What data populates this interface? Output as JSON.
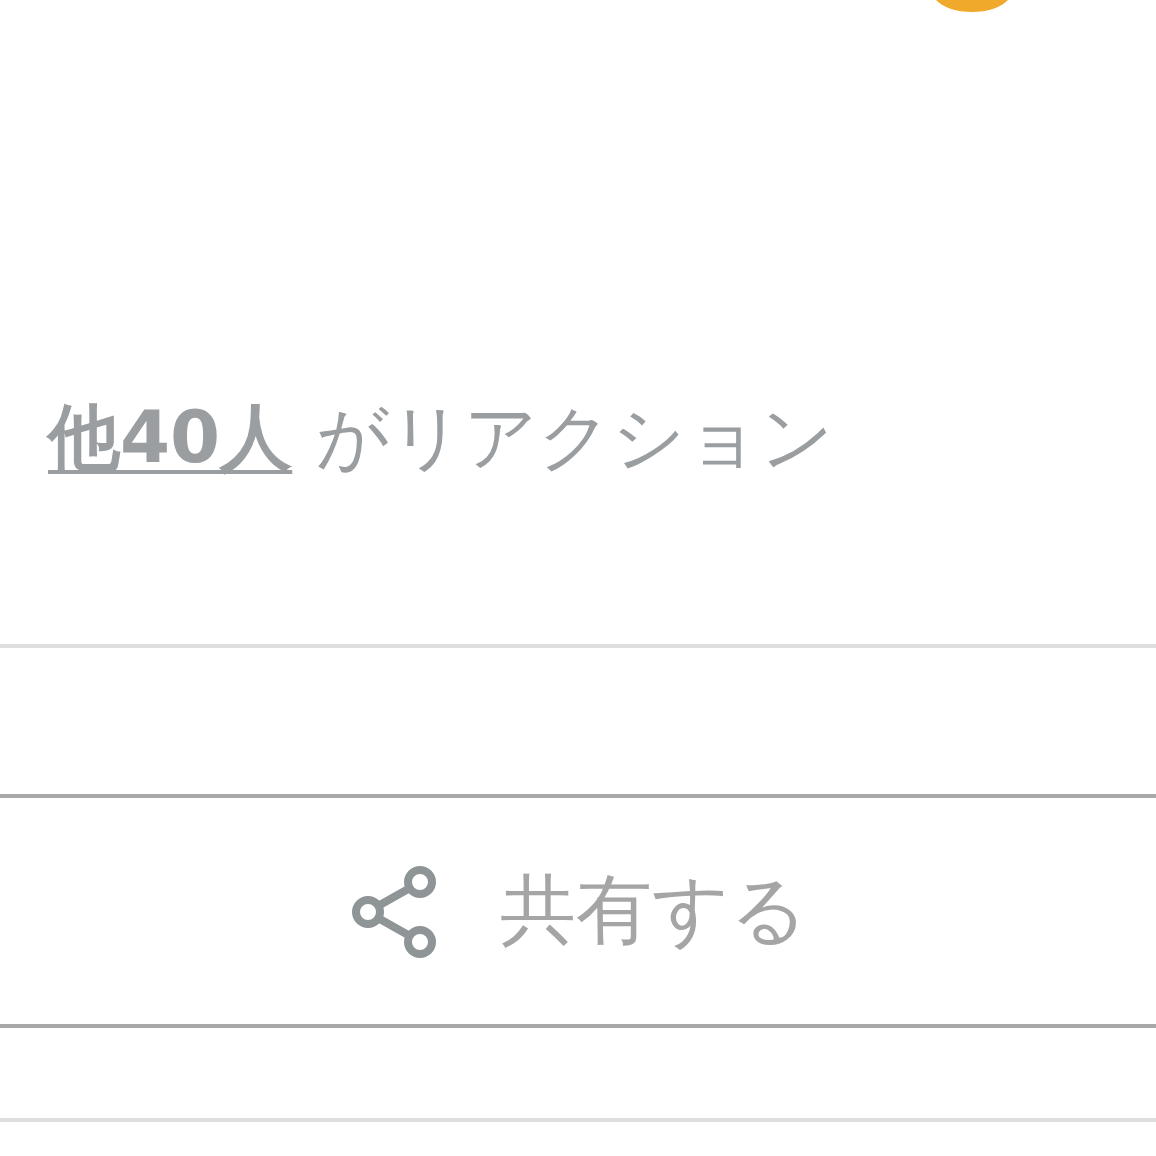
{
  "reactions": {
    "link": "他40人",
    "text": "がリアクション"
  },
  "share_button": {
    "label": "共有する"
  }
}
